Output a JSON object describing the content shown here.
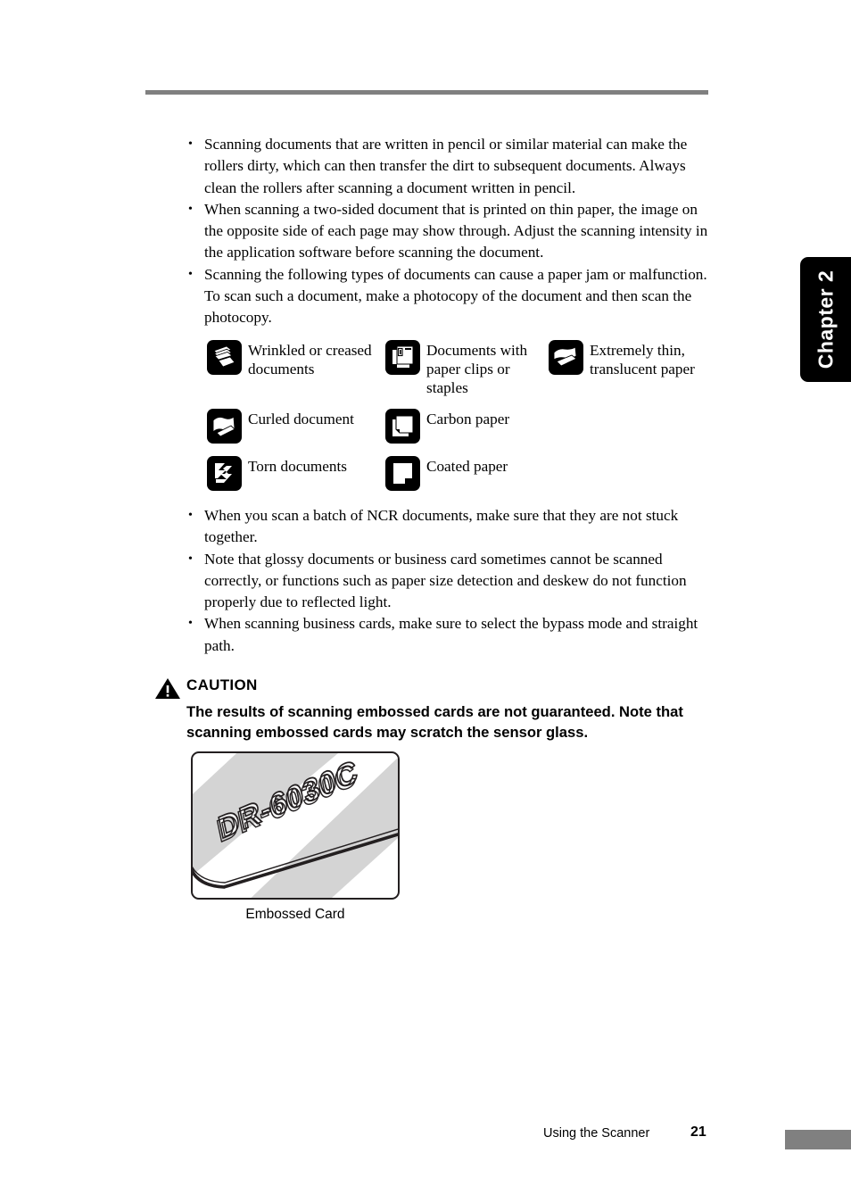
{
  "page": {
    "chapter_tab": "Chapter 2",
    "rule_color": "#808080"
  },
  "notes_top": [
    "Scanning documents that are written in pencil or similar material can make the rollers dirty, which can then transfer the dirt to subsequent documents. Always clean the rollers after scanning a document written in pencil.",
    "When scanning a two-sided document that is printed on thin paper, the image on the opposite side of each page may show through. Adjust the scanning intensity in the application software before scanning the document.",
    "Scanning the following types of documents can cause a paper jam or malfunction. To scan such a document, make a photocopy of the document and then scan the photocopy."
  ],
  "icon_grid": {
    "row1": [
      {
        "icon": "wrinkled-documents-icon",
        "label": "Wrinkled or creased documents"
      },
      {
        "icon": "paper-clips-staples-icon",
        "label": "Documents with paper clips or staples"
      },
      {
        "icon": "translucent-paper-icon",
        "label": "Extremely thin, translucent paper"
      }
    ],
    "row2": [
      {
        "icon": "curled-document-icon",
        "label": "Curled document"
      },
      {
        "icon": "carbon-paper-icon",
        "label": "Carbon paper"
      }
    ],
    "row3": [
      {
        "icon": "torn-documents-icon",
        "label": "Torn documents"
      },
      {
        "icon": "coated-paper-icon",
        "label": "Coated paper"
      }
    ]
  },
  "notes_bottom": [
    "When you scan a batch of NCR documents, make sure that they are not stuck together.",
    "Note that glossy documents or business card sometimes cannot be scanned correctly, or functions such as paper size detection and deskew do not function properly due to reflected light.",
    "When scanning business cards, make sure to select the bypass mode and straight path."
  ],
  "caution": {
    "icon": "warning-triangle-icon",
    "title": "CAUTION",
    "body": "The results of scanning embossed cards are not guaranteed. Note that scanning embossed cards may scratch the sensor glass."
  },
  "figure": {
    "embossed_text": "DR-6030C",
    "caption": "Embossed Card"
  },
  "footer": {
    "section": "Using the Scanner",
    "page_number": "21"
  }
}
